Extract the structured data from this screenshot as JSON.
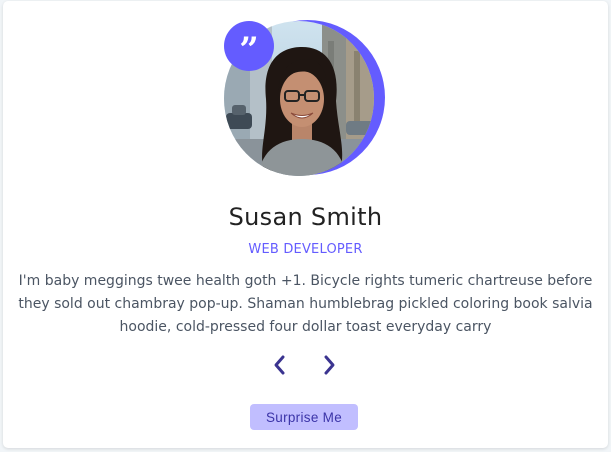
{
  "review": {
    "quote_glyph": "”",
    "name": "Susan Smith",
    "job": "WEB DEVELOPER",
    "text": "I'm baby meggings twee health goth +1. Bicycle rights tumeric chartreuse before they sold out chambray pop-up. Shaman humblebrag pickled coloring book salvia hoodie, cold-pressed four dollar toast everyday carry"
  },
  "controls": {
    "prev_icon": "chevron-left-icon",
    "next_icon": "chevron-right-icon",
    "random_label": "Surprise Me"
  },
  "colors": {
    "accent": "#645cff",
    "accent_light": "#c1beff",
    "chevron": "#3b3490",
    "background": "#f1f5f8"
  }
}
